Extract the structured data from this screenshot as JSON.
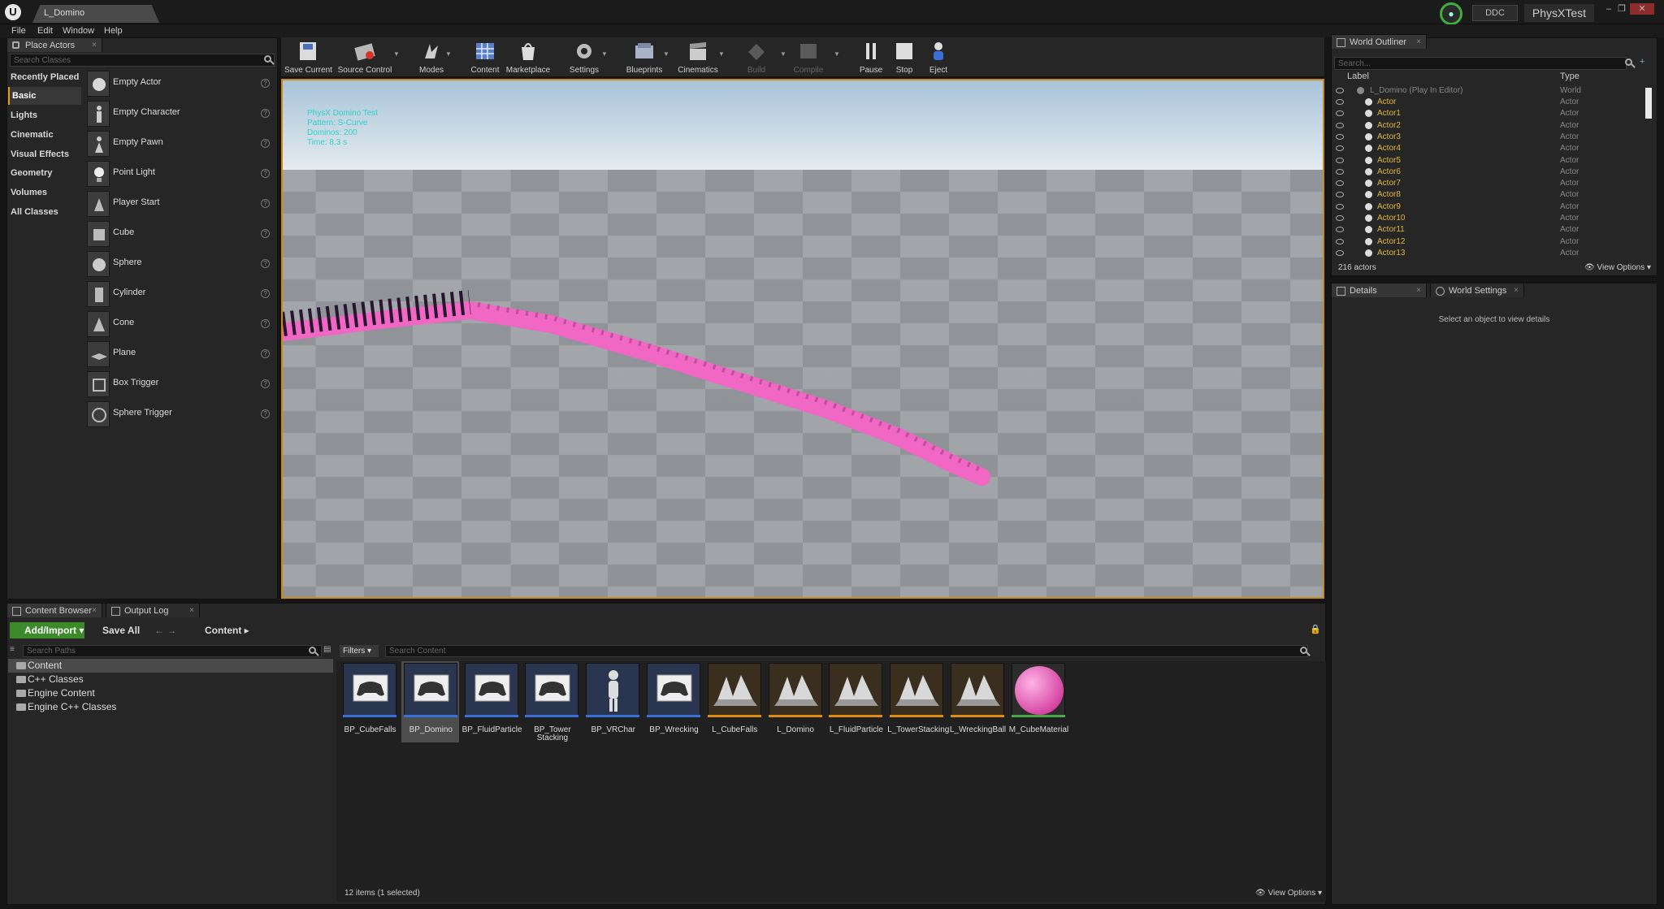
{
  "window": {
    "tab_title": "L_Domino",
    "ddc": "DDC",
    "project": "PhysXTest"
  },
  "menu": [
    "File",
    "Edit",
    "Window",
    "Help"
  ],
  "place_actors": {
    "tab": "Place Actors",
    "search_placeholder": "Search Classes",
    "categories": [
      "Recently Placed",
      "Basic",
      "Lights",
      "Cinematic",
      "Visual Effects",
      "Geometry",
      "Volumes",
      "All Classes"
    ],
    "active_category": "Basic",
    "actors": [
      "Empty Actor",
      "Empty Character",
      "Empty Pawn",
      "Point Light",
      "Player Start",
      "Cube",
      "Sphere",
      "Cylinder",
      "Cone",
      "Plane",
      "Box Trigger",
      "Sphere Trigger"
    ]
  },
  "toolbar": {
    "save_current": "Save Current",
    "source_control": "Source Control",
    "modes": "Modes",
    "content": "Content",
    "marketplace": "Marketplace",
    "settings": "Settings",
    "blueprints": "Blueprints",
    "cinematics": "Cinematics",
    "build": "Build",
    "compile": "Compile",
    "pause": "Pause",
    "stop": "Stop",
    "eject": "Eject"
  },
  "viewport": {
    "hud": [
      "PhysX Domino Test",
      "Pattern: S-Curve",
      "Dominos: 200",
      "Time: 8.3 s"
    ],
    "domino_color": "#f067c4"
  },
  "outliner": {
    "tab": "World Outliner",
    "search_placeholder": "Search...",
    "col_label": "Label",
    "col_type": "Type",
    "world_row": {
      "label": "L_Domino (Play In Editor)",
      "type": "World"
    },
    "actors": [
      "Actor",
      "Actor1",
      "Actor2",
      "Actor3",
      "Actor4",
      "Actor5",
      "Actor6",
      "Actor7",
      "Actor8",
      "Actor9",
      "Actor10",
      "Actor11",
      "Actor12",
      "Actor13"
    ],
    "actor_type": "Actor",
    "count": "216 actors",
    "view_options": "View Options"
  },
  "details": {
    "tab_details": "Details",
    "tab_world_settings": "World Settings",
    "empty_message": "Select an object to view details"
  },
  "content_browser": {
    "tab": "Content Browser",
    "tab_output_log": "Output Log",
    "add_import": "Add/Import",
    "save_all": "Save All",
    "breadcrumb": "Content",
    "search_paths_placeholder": "Search Paths",
    "tree": [
      "Content",
      "C++ Classes",
      "Engine Content",
      "Engine C++ Classes"
    ],
    "filters": "Filters",
    "search_content_placeholder": "Search Content",
    "assets": [
      {
        "name": "BP_CubeFalls",
        "kind": "blueprint"
      },
      {
        "name": "BP_Domino",
        "kind": "blueprint",
        "selected": true
      },
      {
        "name": "BP_FluidParticle",
        "kind": "blueprint"
      },
      {
        "name": "BP_Tower Stacking",
        "kind": "blueprint"
      },
      {
        "name": "BP_VRChar",
        "kind": "character"
      },
      {
        "name": "BP_Wrecking",
        "kind": "blueprint"
      },
      {
        "name": "L_CubeFalls",
        "kind": "level"
      },
      {
        "name": "L_Domino",
        "kind": "level"
      },
      {
        "name": "L_FluidParticle",
        "kind": "level"
      },
      {
        "name": "L_TowerStacking",
        "kind": "level"
      },
      {
        "name": "L_WreckingBall",
        "kind": "level"
      },
      {
        "name": "M_CubeMaterial",
        "kind": "material"
      }
    ],
    "items_count": "12 items (1 selected)",
    "view_options": "View Options"
  },
  "colors": {
    "accent_orange": "#c98a1b",
    "add_import_green": "#3d8a2a",
    "blueprint_bar": "#3a6fd8",
    "level_bar": "#e08a10",
    "material_bar": "#4aa84a"
  }
}
